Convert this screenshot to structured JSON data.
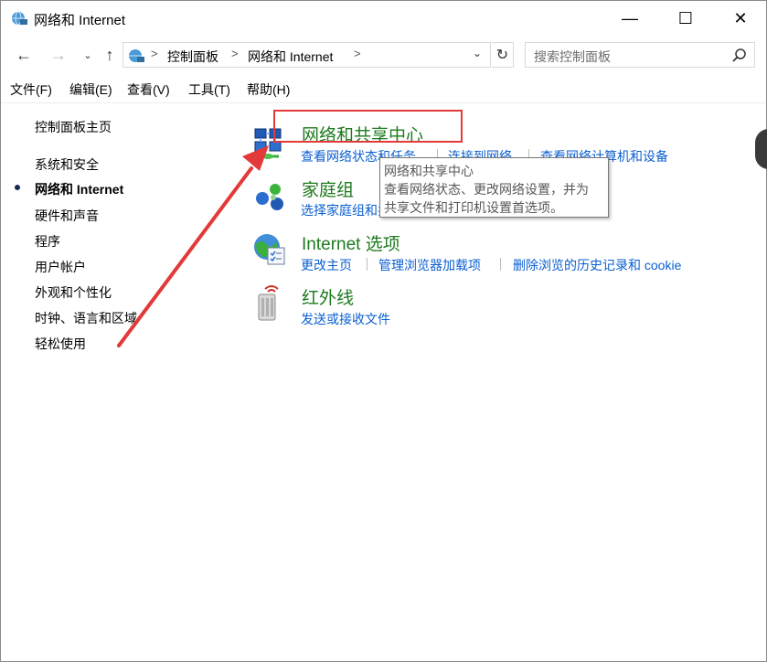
{
  "window": {
    "title": "网络和 Internet",
    "minimize_glyph": "—",
    "maximize_glyph": "☐",
    "close_glyph": "✕"
  },
  "nav": {
    "back_glyph": "←",
    "forward_glyph": "→",
    "recent_glyph": "⌄",
    "up_glyph": "↑",
    "breadcrumbs": [
      "控制面板",
      "网络和 Internet"
    ],
    "separator": ">",
    "dropdown_glyph": "⌄",
    "refresh_glyph": "↻",
    "search_placeholder": "搜索控制面板"
  },
  "menu": {
    "items": [
      "文件(F)",
      "编辑(E)",
      "查看(V)",
      "工具(T)",
      "帮助(H)"
    ]
  },
  "sidebar": {
    "home": "控制面板主页",
    "items": [
      {
        "label": "系统和安全",
        "current": false
      },
      {
        "label": "网络和 Internet",
        "current": true
      },
      {
        "label": "硬件和声音",
        "current": false
      },
      {
        "label": "程序",
        "current": false
      },
      {
        "label": "用户帐户",
        "current": false
      },
      {
        "label": "外观和个性化",
        "current": false
      },
      {
        "label": "时钟、语言和区域",
        "current": false
      },
      {
        "label": "轻松使用",
        "current": false
      }
    ]
  },
  "categories": [
    {
      "icon": "network-sharing-center-icon",
      "title": "网络和共享中心",
      "links": [
        "查看网络状态和任务",
        "连接到网络",
        "查看网络计算机和设备"
      ]
    },
    {
      "icon": "homegroup-icon",
      "title": "家庭组",
      "links": [
        "选择家庭组和共享选项"
      ]
    },
    {
      "icon": "internet-options-icon",
      "title": "Internet 选项",
      "links": [
        "更改主页",
        "管理浏览器加载项",
        "删除浏览的历史记录和 cookie"
      ]
    },
    {
      "icon": "infrared-icon",
      "title": "红外线",
      "links": [
        "发送或接收文件"
      ]
    }
  ],
  "tooltip": {
    "title": "网络和共享中心",
    "line1": "查看网络状态、更改网络设置，并为",
    "line2": "共享文件和打印机设置首选项。"
  },
  "colors": {
    "category_title": "#1e7a1e",
    "link": "#0a5fd0",
    "annotation": "#e23a3a"
  }
}
